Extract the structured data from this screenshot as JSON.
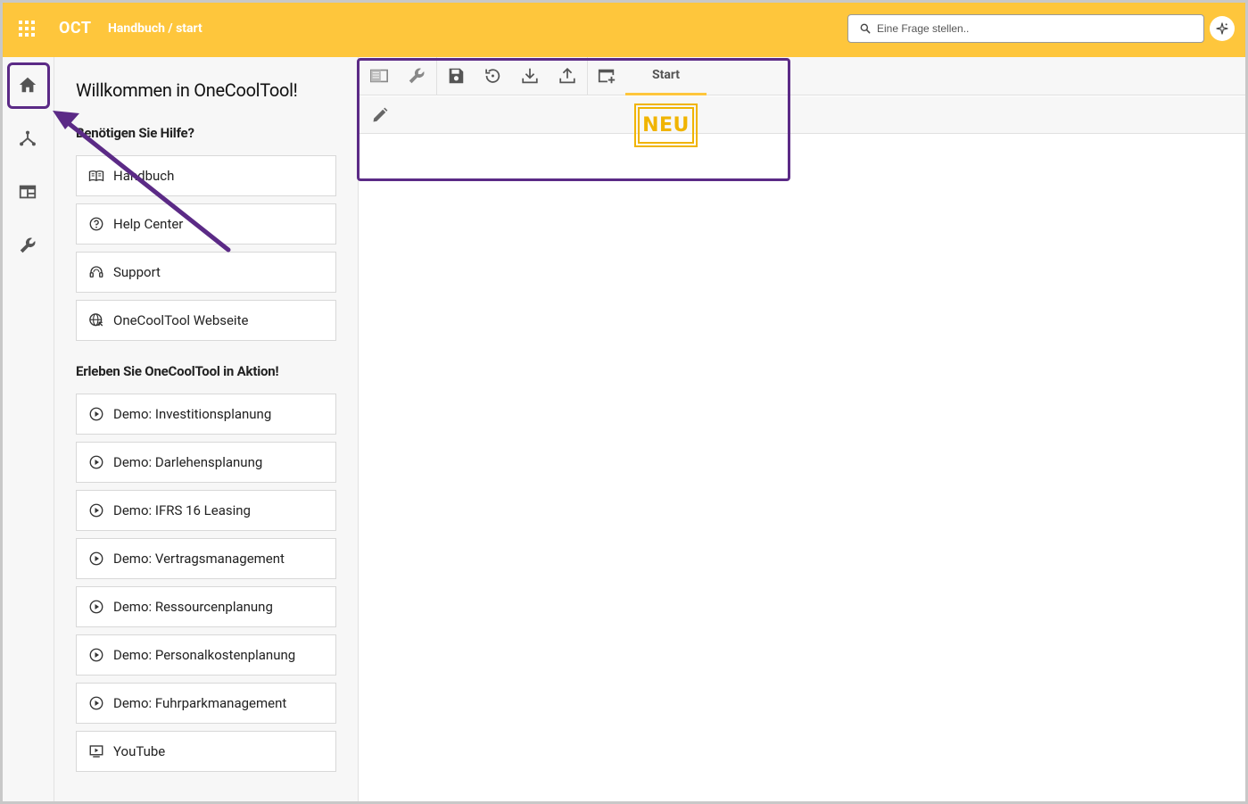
{
  "header": {
    "brand": "OCT",
    "breadcrumb": "Handbuch / start",
    "search_placeholder": "Eine Frage stellen.."
  },
  "rail": {
    "items": [
      {
        "icon": "home-icon"
      },
      {
        "icon": "hierarchy-icon"
      },
      {
        "icon": "window-icon"
      },
      {
        "icon": "wrench-icon"
      }
    ]
  },
  "panel": {
    "welcome": "Willkommen in OneCoolTool!",
    "help_heading": "Benötigen Sie Hilfe?",
    "help_links": [
      {
        "label": "Handbuch",
        "icon": "book-icon"
      },
      {
        "label": "Help Center",
        "icon": "question-icon"
      },
      {
        "label": "Support",
        "icon": "headset-icon"
      },
      {
        "label": "OneCoolTool Webseite",
        "icon": "globe-icon"
      }
    ],
    "demo_heading": "Erleben Sie OneCoolTool in Aktion!",
    "demo_links": [
      {
        "label": "Demo: Investitionsplanung",
        "icon": "play-icon"
      },
      {
        "label": "Demo: Darlehensplanung",
        "icon": "play-icon"
      },
      {
        "label": "Demo: IFRS 16 Leasing",
        "icon": "play-icon"
      },
      {
        "label": "Demo: Vertragsmanagement",
        "icon": "play-icon"
      },
      {
        "label": "Demo: Ressourcenplanung",
        "icon": "play-icon"
      },
      {
        "label": "Demo: Personalkostenplanung",
        "icon": "play-icon"
      },
      {
        "label": "Demo: Fuhrparkmanagement",
        "icon": "play-icon"
      },
      {
        "label": "YouTube",
        "icon": "youtube-icon"
      }
    ]
  },
  "toolbar": {
    "buttons": [
      "sidebar-icon",
      "wrench-icon",
      "save-icon",
      "history-icon",
      "download-icon",
      "upload-icon",
      "add-window-icon"
    ],
    "tab_label": "Start"
  },
  "badge": {
    "text": "NEU",
    "color": "#f0b400"
  },
  "colors": {
    "accent": "#fec63c",
    "annotation": "#5b2a86"
  }
}
